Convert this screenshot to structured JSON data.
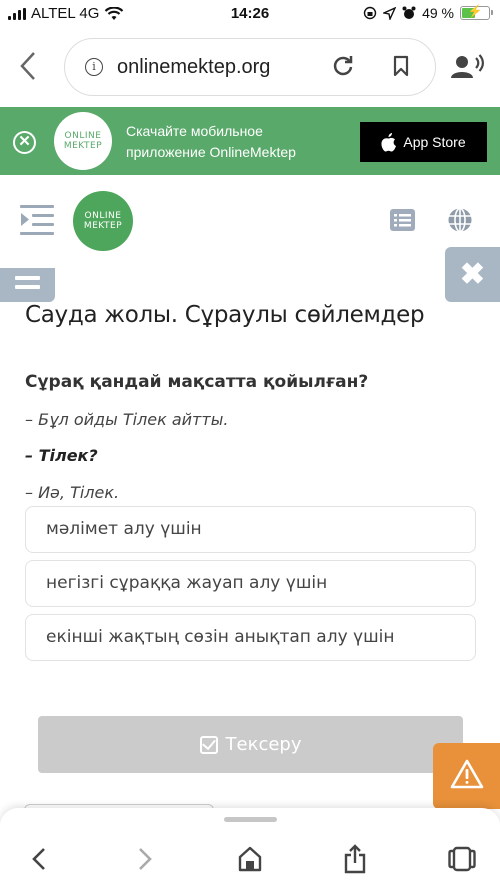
{
  "status_bar": {
    "carrier": "ALTEL 4G",
    "time": "14:26",
    "battery_percent": "49 %",
    "battery_level": 0.49,
    "icons": [
      "signal-icon",
      "wifi-icon",
      "screen-lock-icon",
      "location-icon",
      "alarm-icon",
      "battery-charging-icon"
    ]
  },
  "browser": {
    "url": "onlinemektep.org",
    "back_icon": "chevron-left-icon",
    "info_icon": "info-icon",
    "reload_icon": "reload-icon",
    "bookmark_icon": "bookmark-icon",
    "listen_icon": "speaker-person-icon"
  },
  "banner": {
    "logo_line1": "ONLINE",
    "logo_line2": "MEKTEP",
    "promo_text": "Скачайте мобильное приложение OnlineMektep",
    "store_button": "App Store",
    "accent_color": "#59a96a"
  },
  "site_header": {
    "logo_line1": "ONLINE",
    "logo_line2": "MEKTEP",
    "logo_color": "#4ea65c"
  },
  "lesson": {
    "title": "Сауда жолы. Сұраулы сөйлемдер",
    "question": "Сұрақ қандай мақсатта қойылған?",
    "dialog": [
      "– Бұл ойды Тілек айтты.",
      "– Тілек?",
      "– Иә, Тілек."
    ],
    "options": [
      "мәлімет алу үшін",
      "негізгі сұраққа жауап алу үшін",
      "екінші жақтың сөзін анықтап алу үшін"
    ],
    "check_button": "Тексеру"
  },
  "colors": {
    "report_button": "#e8913a",
    "side_buttons": "#a9b6c4",
    "check_button_disabled": "#cbcbcb"
  }
}
